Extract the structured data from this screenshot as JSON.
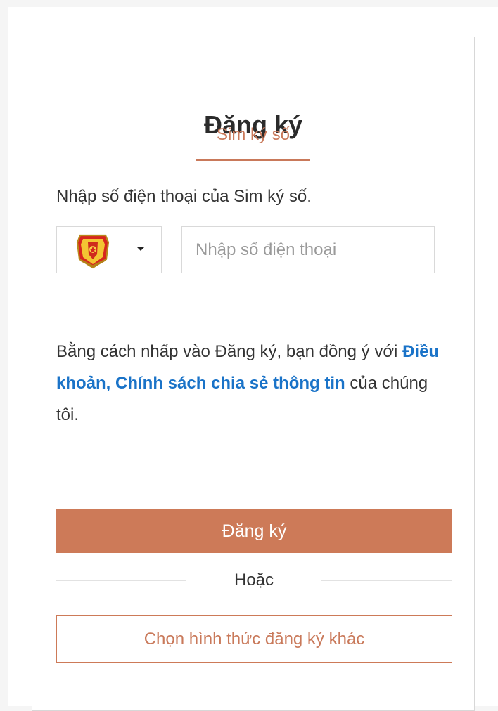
{
  "form": {
    "title": "Đăng ký",
    "tab_label": "Sim ký số",
    "instruction": "Nhập số điện thoại của Sim ký số.",
    "country_select": {
      "icon": "national-emblem-icon",
      "caret_icon": "caret-down-icon"
    },
    "phone_input": {
      "value": "",
      "placeholder": "Nhập số điện thoại"
    },
    "terms": {
      "prefix": "Bằng cách nhấp vào Đăng ký, bạn đồng ý với ",
      "link_text": "Điều khoản, Chính sách chia sẻ thông tin",
      "suffix": " của chúng tôi."
    },
    "submit_label": "Đăng ký",
    "or_label": "Hoặc",
    "alternative_label": "Chọn hình thức đăng ký khác"
  },
  "colors": {
    "accent": "#cd7a58",
    "link": "#1a73c8",
    "text": "#333333",
    "border": "#d9d9d9"
  }
}
